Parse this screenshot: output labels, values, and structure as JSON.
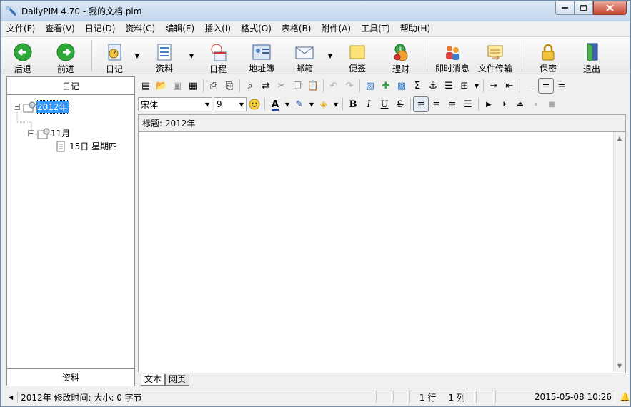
{
  "window": {
    "title": "DailyPIM 4.70 - 我的文档.pim"
  },
  "menu": [
    "文件(F)",
    "查看(V)",
    "日记(D)",
    "资料(C)",
    "编辑(E)",
    "插入(I)",
    "格式(O)",
    "表格(B)",
    "附件(A)",
    "工具(T)",
    "帮助(H)"
  ],
  "toolbar": {
    "back": "后退",
    "forward": "前进",
    "diary": "日记",
    "data": "资料",
    "schedule": "日程",
    "addressbook": "地址簿",
    "mail": "邮箱",
    "note": "便签",
    "finance": "理财",
    "im": "即时消息",
    "filetransfer": "文件传输",
    "secure": "保密",
    "exit": "退出"
  },
  "left_panel": {
    "header": "日记",
    "footer": "资料",
    "tree": {
      "year": "2012年",
      "month": "11月",
      "day": "15日 星期四"
    }
  },
  "format": {
    "font": "宋体",
    "size": "9"
  },
  "doc": {
    "title_field": "标题: 2012年"
  },
  "tabs": [
    "文本",
    "网页"
  ],
  "status": {
    "info": "2012年 修改时间: 大小: 0 字节",
    "row": "1 行",
    "col": "1 列",
    "datetime": "2015-05-08 10:26"
  },
  "colors": {
    "selection": "#3399ff",
    "green_arrow": "#2fa83a",
    "close_button": "#c7452f"
  }
}
